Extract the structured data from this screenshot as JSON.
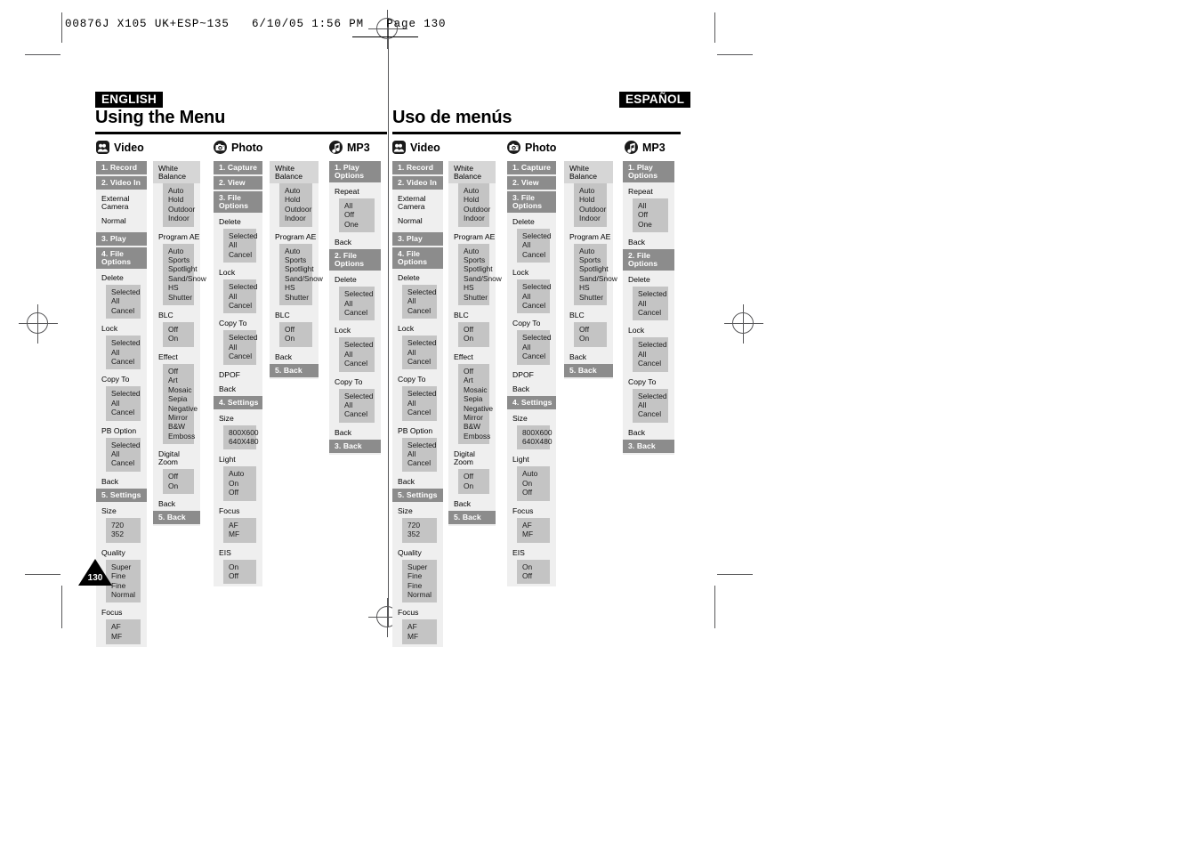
{
  "print_slug": "00876J X105 UK+ESP~135   6/10/05 1:56 PM   Page 130",
  "page_number": "130",
  "left_page": {
    "language_label": "ENGLISH",
    "title": "Using the Menu"
  },
  "right_page": {
    "language_label": "ESPAÑOL",
    "title": "Uso de menús"
  },
  "sections": {
    "video": {
      "label": "Video",
      "icon": "camcorder-icon"
    },
    "photo": {
      "label": "Photo",
      "icon": "camera-icon"
    },
    "mp3": {
      "label": "MP3",
      "icon": "music-note-icon"
    }
  },
  "menus": {
    "video_main": [
      {
        "type": "num",
        "text": "1. Record"
      },
      {
        "type": "num",
        "text": "2. Video In"
      },
      {
        "type": "plain",
        "text": "External Camera"
      },
      {
        "type": "plain",
        "text": "Normal"
      },
      {
        "type": "gap"
      },
      {
        "type": "num",
        "text": "3. Play"
      },
      {
        "type": "num",
        "text": "4. File Options"
      },
      {
        "type": "cat",
        "text": "Delete"
      },
      {
        "type": "opts",
        "items": [
          "Selected",
          "All",
          "Cancel"
        ]
      },
      {
        "type": "cat",
        "text": "Lock"
      },
      {
        "type": "opts",
        "items": [
          "Selected",
          "All",
          "Cancel"
        ]
      },
      {
        "type": "cat",
        "text": "Copy To"
      },
      {
        "type": "opts",
        "items": [
          "Selected",
          "All",
          "Cancel"
        ]
      },
      {
        "type": "cat",
        "text": "PB Option"
      },
      {
        "type": "opts",
        "items": [
          "Selected",
          "All",
          "Cancel"
        ]
      },
      {
        "type": "cat",
        "text": "Back"
      },
      {
        "type": "num",
        "text": "5. Settings"
      },
      {
        "type": "cat",
        "text": "Size"
      },
      {
        "type": "opts",
        "items": [
          "720",
          "352"
        ]
      },
      {
        "type": "cat",
        "text": "Quality"
      },
      {
        "type": "opts",
        "items": [
          "Super Fine",
          "Fine",
          "Normal"
        ]
      },
      {
        "type": "cat",
        "text": "Focus"
      },
      {
        "type": "opts",
        "items": [
          "AF",
          "MF"
        ]
      }
    ],
    "video_sub": [
      {
        "type": "cat",
        "text": "White Balance",
        "shaded": true
      },
      {
        "type": "opts",
        "items": [
          "Auto",
          "Hold",
          "Outdoor",
          "Indoor"
        ]
      },
      {
        "type": "cat",
        "text": "Program AE"
      },
      {
        "type": "opts",
        "items": [
          "Auto",
          "Sports",
          "Spotlight",
          "Sand/Snow",
          "HS Shutter"
        ]
      },
      {
        "type": "cat",
        "text": "BLC"
      },
      {
        "type": "opts",
        "items": [
          "Off",
          "On"
        ]
      },
      {
        "type": "cat",
        "text": "Effect"
      },
      {
        "type": "opts",
        "items": [
          "Off",
          "Art",
          "Mosaic",
          "Sepia",
          "Negative",
          "Mirror",
          "B&W",
          "Emboss"
        ]
      },
      {
        "type": "cat",
        "text": "Digital Zoom"
      },
      {
        "type": "opts",
        "items": [
          "Off",
          "On"
        ]
      },
      {
        "type": "cat",
        "text": "Back"
      },
      {
        "type": "num",
        "text": "5. Back"
      }
    ],
    "photo_main": [
      {
        "type": "num",
        "text": "1. Capture"
      },
      {
        "type": "num",
        "text": "2. View"
      },
      {
        "type": "num",
        "text": "3. File Options"
      },
      {
        "type": "cat",
        "text": "Delete"
      },
      {
        "type": "opts",
        "items": [
          "Selected",
          "All",
          "Cancel"
        ]
      },
      {
        "type": "cat",
        "text": "Lock"
      },
      {
        "type": "opts",
        "items": [
          "Selected",
          "All",
          "Cancel"
        ]
      },
      {
        "type": "cat",
        "text": "Copy To"
      },
      {
        "type": "opts",
        "items": [
          "Selected",
          "All",
          "Cancel"
        ]
      },
      {
        "type": "cat",
        "text": "DPOF"
      },
      {
        "type": "cat",
        "text": "Back"
      },
      {
        "type": "num",
        "text": "4. Settings"
      },
      {
        "type": "cat",
        "text": "Size"
      },
      {
        "type": "opts",
        "items": [
          "800X600",
          "640X480"
        ]
      },
      {
        "type": "cat",
        "text": "Light"
      },
      {
        "type": "opts",
        "items": [
          "Auto",
          "On",
          "Off"
        ]
      },
      {
        "type": "cat",
        "text": "Focus"
      },
      {
        "type": "opts",
        "items": [
          "AF",
          "MF"
        ]
      },
      {
        "type": "cat",
        "text": "EIS"
      },
      {
        "type": "opts",
        "items": [
          "On",
          "Off"
        ]
      }
    ],
    "photo_sub": [
      {
        "type": "cat",
        "text": "White Balance",
        "shaded": true
      },
      {
        "type": "opts",
        "items": [
          "Auto",
          "Hold",
          "Outdoor",
          "Indoor"
        ]
      },
      {
        "type": "cat",
        "text": "Program AE"
      },
      {
        "type": "opts",
        "items": [
          "Auto",
          "Sports",
          "Spotlight",
          "Sand/Snow",
          "HS Shutter"
        ]
      },
      {
        "type": "cat",
        "text": "BLC"
      },
      {
        "type": "opts",
        "items": [
          "Off",
          "On"
        ]
      },
      {
        "type": "cat",
        "text": "Back"
      },
      {
        "type": "num",
        "text": "5. Back"
      }
    ],
    "mp3_main": [
      {
        "type": "num",
        "text": "1. Play Options"
      },
      {
        "type": "cat",
        "text": "Repeat"
      },
      {
        "type": "opts",
        "items": [
          "All",
          "Off",
          "One"
        ]
      },
      {
        "type": "cat",
        "text": "Back"
      },
      {
        "type": "num",
        "text": "2. File Options"
      },
      {
        "type": "cat",
        "text": "Delete"
      },
      {
        "type": "opts",
        "items": [
          "Selected",
          "All",
          "Cancel"
        ]
      },
      {
        "type": "cat",
        "text": "Lock"
      },
      {
        "type": "opts",
        "items": [
          "Selected",
          "All",
          "Cancel"
        ]
      },
      {
        "type": "cat",
        "text": "Copy To"
      },
      {
        "type": "opts",
        "items": [
          "Selected",
          "All",
          "Cancel"
        ]
      },
      {
        "type": "cat",
        "text": "Back"
      },
      {
        "type": "num",
        "text": "3. Back"
      }
    ]
  },
  "colors": {
    "num_bg": "#8c8c8c",
    "opts_bg": "#c4c4c4",
    "panel_bg": "#efefef",
    "shaded_bg": "#d6d6d6",
    "ink": "#000000"
  }
}
